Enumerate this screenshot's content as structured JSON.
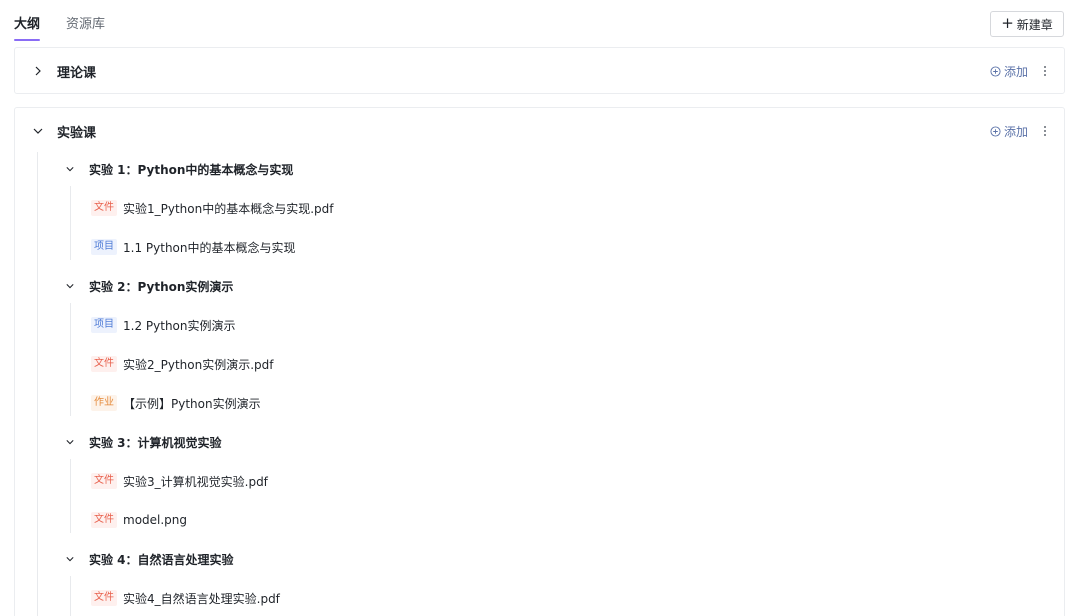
{
  "tabs": [
    {
      "label": "大纲",
      "active": true
    },
    {
      "label": "资源库",
      "active": false
    }
  ],
  "toolbar": {
    "new_chapter_label": "新建章",
    "new_chapter_icon": "plus-icon"
  },
  "chapters": [
    {
      "title": "理论课",
      "expanded": false,
      "add_label": "添加"
    },
    {
      "title": "实验课",
      "expanded": true,
      "add_label": "添加",
      "sections": [
        {
          "title": "实验 1：Python中的基本概念与实现",
          "items": [
            {
              "tag": "文件",
              "type": "file",
              "name": "实验1_Python中的基本概念与实现.pdf"
            },
            {
              "tag": "项目",
              "type": "project",
              "name": "1.1 Python中的基本概念与实现"
            }
          ]
        },
        {
          "title": "实验 2：Python实例演示",
          "items": [
            {
              "tag": "项目",
              "type": "project",
              "name": "1.2 Python实例演示"
            },
            {
              "tag": "文件",
              "type": "file",
              "name": "实验2_Python实例演示.pdf"
            },
            {
              "tag": "作业",
              "type": "homework",
              "name": "【示例】Python实例演示"
            }
          ]
        },
        {
          "title": "实验 3：计算机视觉实验",
          "items": [
            {
              "tag": "文件",
              "type": "file",
              "name": "实验3_计算机视觉实验.pdf"
            },
            {
              "tag": "文件",
              "type": "file",
              "name": "model.png"
            }
          ]
        },
        {
          "title": "实验 4：自然语言处理实验",
          "items": [
            {
              "tag": "文件",
              "type": "file",
              "name": "实验4_自然语言处理实验.pdf"
            }
          ]
        }
      ]
    }
  ],
  "colors": {
    "accent": "#8a6cf5",
    "link": "#5b72a8",
    "file_tag": "#e8604c",
    "project_tag": "#4e7bd6",
    "homework_tag": "#e58a3a"
  }
}
